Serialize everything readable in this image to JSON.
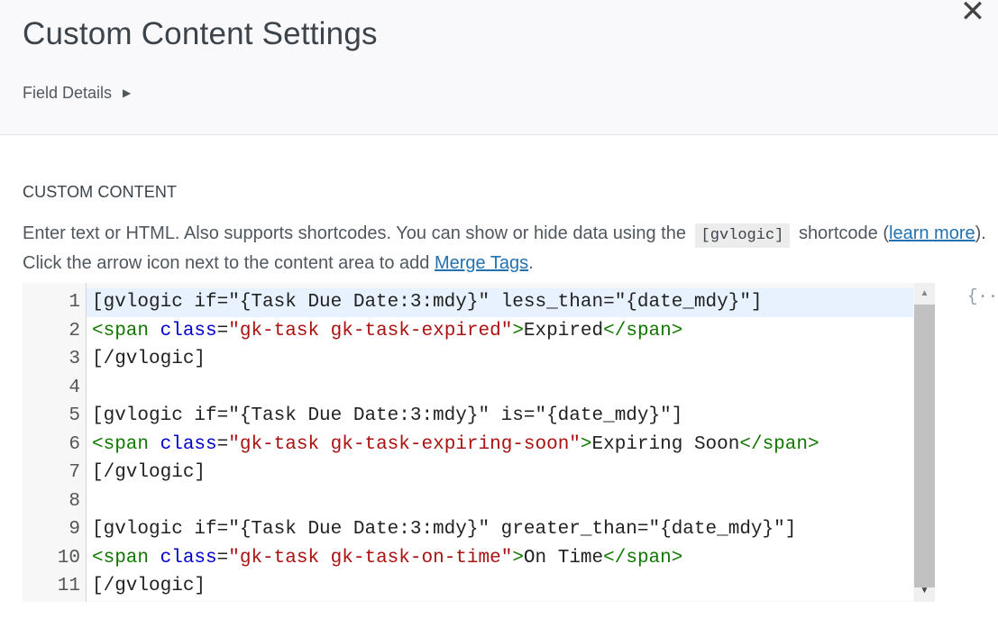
{
  "header": {
    "title": "Custom Content Settings",
    "close_glyph": "✕",
    "field_details_label": "Field Details",
    "field_details_arrow": "▶"
  },
  "section": {
    "label": "CUSTOM CONTENT",
    "help": {
      "part1": "Enter text or HTML. Also supports shortcodes. You can show or hide data using the",
      "code": "[gvlogic]",
      "part2": "shortcode (",
      "learn_more": "learn more",
      "part3": "). Click the arrow icon next to the content area to add ",
      "merge_tags": "Merge Tags",
      "part4": "."
    }
  },
  "editor": {
    "lines": [
      {
        "num": "1",
        "segments": [
          {
            "t": "[gvlogic if=\"{Task Due Date:3:mdy}\" less_than=\"{date_mdy}\"]",
            "c": "plain"
          }
        ]
      },
      {
        "num": "2",
        "segments": [
          {
            "t": "<span",
            "c": "tag"
          },
          {
            "t": " ",
            "c": "plain"
          },
          {
            "t": "class",
            "c": "attr"
          },
          {
            "t": "=",
            "c": "plain"
          },
          {
            "t": "\"gk-task gk-task-expired\"",
            "c": "str"
          },
          {
            "t": ">",
            "c": "tag"
          },
          {
            "t": "Expired",
            "c": "plain"
          },
          {
            "t": "</span>",
            "c": "tag"
          }
        ]
      },
      {
        "num": "3",
        "segments": [
          {
            "t": "[/gvlogic]",
            "c": "plain"
          }
        ]
      },
      {
        "num": "4",
        "segments": [
          {
            "t": "",
            "c": "plain"
          }
        ]
      },
      {
        "num": "5",
        "segments": [
          {
            "t": "[gvlogic if=\"{Task Due Date:3:mdy}\" is=\"{date_mdy}\"]",
            "c": "plain"
          }
        ]
      },
      {
        "num": "6",
        "segments": [
          {
            "t": "<span",
            "c": "tag"
          },
          {
            "t": " ",
            "c": "plain"
          },
          {
            "t": "class",
            "c": "attr"
          },
          {
            "t": "=",
            "c": "plain"
          },
          {
            "t": "\"gk-task gk-task-expiring-soon\"",
            "c": "str"
          },
          {
            "t": ">",
            "c": "tag"
          },
          {
            "t": "Expiring Soon",
            "c": "plain"
          },
          {
            "t": "</span>",
            "c": "tag"
          }
        ]
      },
      {
        "num": "7",
        "segments": [
          {
            "t": "[/gvlogic]",
            "c": "plain"
          }
        ]
      },
      {
        "num": "8",
        "segments": [
          {
            "t": "",
            "c": "plain"
          }
        ]
      },
      {
        "num": "9",
        "segments": [
          {
            "t": "[gvlogic if=\"{Task Due Date:3:mdy}\" greater_than=\"{date_mdy}\"]",
            "c": "plain"
          }
        ]
      },
      {
        "num": "10",
        "segments": [
          {
            "t": "<span",
            "c": "tag"
          },
          {
            "t": " ",
            "c": "plain"
          },
          {
            "t": "class",
            "c": "attr"
          },
          {
            "t": "=",
            "c": "plain"
          },
          {
            "t": "\"gk-task gk-task-on-time\"",
            "c": "str"
          },
          {
            "t": ">",
            "c": "tag"
          },
          {
            "t": "On Time",
            "c": "plain"
          },
          {
            "t": "</span>",
            "c": "tag"
          }
        ]
      },
      {
        "num": "11",
        "segments": [
          {
            "t": "[/gvlogic]",
            "c": "plain"
          }
        ]
      }
    ],
    "merge_tags_button": "{··}",
    "scroll_up_glyph": "▲",
    "scroll_down_glyph": "▼"
  }
}
